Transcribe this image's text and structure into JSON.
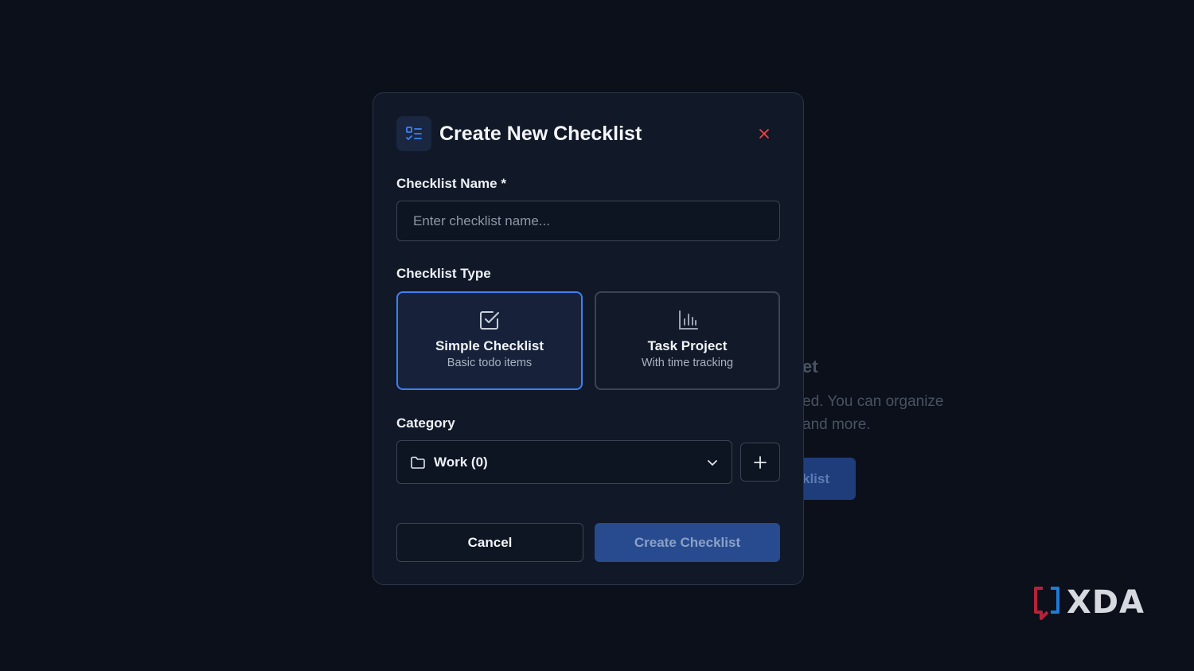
{
  "background": {
    "heading_fragment": "et",
    "text_line1": "ed. You can organize",
    "text_line2": "and more.",
    "button_fragment": "klist"
  },
  "modal": {
    "title": "Create New Checklist",
    "header_icon": "checklist-icon",
    "close_icon": "close-icon",
    "name_field": {
      "label": "Checklist Name *",
      "placeholder": "Enter checklist name...",
      "value": ""
    },
    "type_field": {
      "label": "Checklist Type",
      "options": [
        {
          "title": "Simple Checklist",
          "subtitle": "Basic todo items",
          "icon": "checkbox-icon",
          "selected": true
        },
        {
          "title": "Task Project",
          "subtitle": "With time tracking",
          "icon": "bar-chart-icon",
          "selected": false
        }
      ]
    },
    "category_field": {
      "label": "Category",
      "selected": "Work (0)",
      "icon": "folder-icon",
      "add_icon": "plus-icon"
    },
    "buttons": {
      "cancel": "Cancel",
      "create": "Create Checklist"
    }
  },
  "colors": {
    "background": "#0b101b",
    "modal": "#111827",
    "accent": "#3b82f6",
    "primary_button": "#284b8f",
    "close": "#ef4444"
  },
  "watermark": {
    "text": "XDA"
  }
}
